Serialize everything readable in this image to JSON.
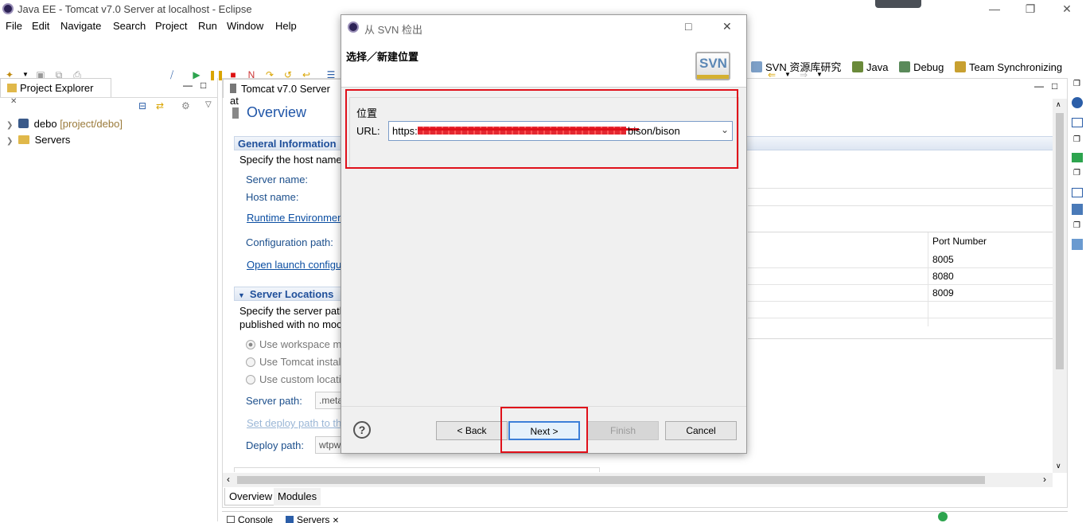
{
  "window": {
    "title": "Java EE - Tomcat v7.0 Server at localhost - Eclipse"
  },
  "menu": [
    "File",
    "Edit",
    "Navigate",
    "Search",
    "Project",
    "Run",
    "Window",
    "Help"
  ],
  "perspectives": [
    {
      "label": "SVN 资源库研究",
      "icon": "svn-repo-icon"
    },
    {
      "label": "Java",
      "icon": "java-icon"
    },
    {
      "label": "Debug",
      "icon": "debug-icon"
    },
    {
      "label": "Team Synchronizing",
      "icon": "team-sync-icon"
    }
  ],
  "project_explorer": {
    "tab_label": "Project Explorer",
    "items": [
      {
        "name": "debo",
        "decoration": "[project/debo]"
      },
      {
        "name": "Servers",
        "decoration": ""
      }
    ]
  },
  "editor": {
    "tab_label": "Tomcat v7.0 Server at",
    "overview_title": "Overview",
    "general_info": {
      "heading": "General Information",
      "desc": "Specify the host name",
      "server_name_label": "Server name:",
      "host_name_label": "Host name:",
      "runtime_env_link": "Runtime Environmen",
      "config_path_label": "Configuration path:",
      "open_launch_link": "Open launch configu"
    },
    "server_locations": {
      "heading": "Server Locations",
      "desc_line1": "Specify the server path",
      "desc_line2": "published with no moc",
      "options": [
        {
          "label": "Use workspace m",
          "selected": true
        },
        {
          "label": "Use Tomcat install",
          "selected": false
        },
        {
          "label": "Use custom locatio",
          "selected": false
        }
      ],
      "server_path_label": "Server path:",
      "server_path_value": ".meta",
      "set_deploy_link": "Set deploy path to th",
      "deploy_path_label": "Deploy path:",
      "deploy_path_value": "wtpw"
    },
    "ports": {
      "column_header": "Port Number",
      "values": [
        "8005",
        "8080",
        "8009"
      ]
    },
    "bottom_tabs": [
      "Overview",
      "Modules"
    ]
  },
  "bottom_views": [
    "Console",
    "Servers"
  ],
  "dialog": {
    "title": "从 SVN 检出",
    "header": "选择／新建位置",
    "logo_text": "SVN",
    "group_label": "位置",
    "url_label": "URL:",
    "url_prefix": "https:",
    "url_suffix": "bison/bison",
    "buttons": {
      "back": "< Back",
      "next": "Next >",
      "finish": "Finish",
      "cancel": "Cancel"
    }
  }
}
